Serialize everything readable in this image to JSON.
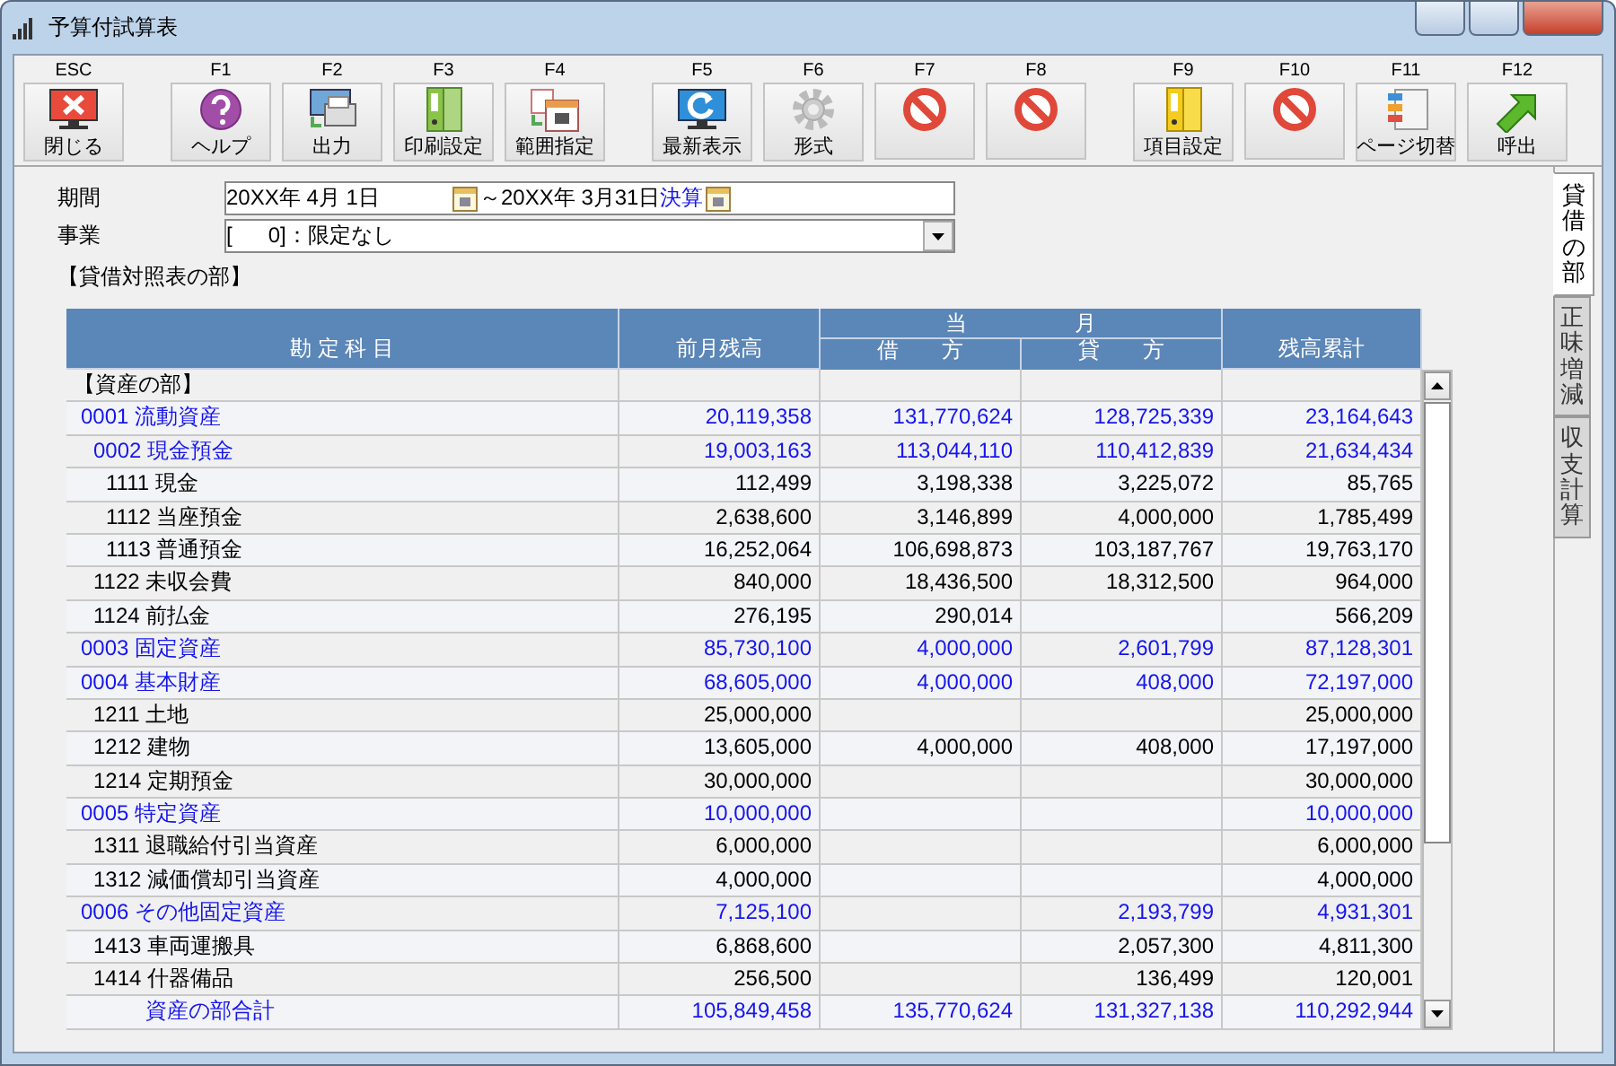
{
  "window": {
    "title": "予算付試算表"
  },
  "toolbar_groups": [
    [
      {
        "key": "ESC",
        "label": "閉じる",
        "kind": "close"
      }
    ],
    [
      {
        "key": "F1",
        "label": "ヘルプ",
        "kind": "help"
      },
      {
        "key": "F2",
        "label": "出力",
        "kind": "output"
      },
      {
        "key": "F3",
        "label": "印刷設定",
        "kind": "binder"
      },
      {
        "key": "F4",
        "label": "範囲指定",
        "kind": "calendar"
      }
    ],
    [
      {
        "key": "F5",
        "label": "最新表示",
        "kind": "refresh"
      },
      {
        "key": "F6",
        "label": "形式",
        "kind": "gear"
      },
      {
        "key": "F7",
        "kind": "blocked"
      },
      {
        "key": "F8",
        "kind": "blocked"
      }
    ],
    [
      {
        "key": "F9",
        "label": "項目設定",
        "kind": "folder"
      },
      {
        "key": "F10",
        "kind": "blocked"
      },
      {
        "key": "F11",
        "label": "ページ切替",
        "kind": "pages"
      },
      {
        "key": "F12",
        "label": "呼出",
        "kind": "arrow"
      }
    ]
  ],
  "filter": {
    "period_label": "期間",
    "period_from": "20XX年 4月 1日",
    "period_to": "～20XX年 3月31日",
    "settlement": "決算",
    "business_label": "事業",
    "business": "[      0]：限定なし"
  },
  "section_title": "【貸借対照表の部】",
  "table": {
    "columns": [
      "勘 定 科 目",
      "前月残高",
      "借　　方",
      "貸　　方",
      "残高累計"
    ],
    "column_group": "当　　　　　月",
    "rows": [
      {
        "kind": "heading",
        "name": "【資産の部】"
      },
      {
        "kind": "group",
        "name": "0001 流動資産",
        "prev": "20,119,358",
        "debit": "131,770,624",
        "credit": "128,725,339",
        "balance": "23,164,643",
        "children": [
          {
            "kind": "group",
            "name": "0002 現金預金",
            "prev": "19,003,163",
            "debit": "113,044,110",
            "credit": "110,412,839",
            "balance": "21,634,434",
            "children": [
              {
                "kind": "account",
                "name": "1111 現金",
                "prev": "112,499",
                "debit": "3,198,338",
                "credit": "3,225,072",
                "balance": "85,765"
              },
              {
                "kind": "account",
                "name": "1112 当座預金",
                "prev": "2,638,600",
                "debit": "3,146,899",
                "credit": "4,000,000",
                "balance": "1,785,499"
              },
              {
                "kind": "account",
                "name": "1113 普通預金",
                "prev": "16,252,064",
                "debit": "106,698,873",
                "credit": "103,187,767",
                "balance": "19,763,170"
              }
            ]
          },
          {
            "kind": "account",
            "name": "1122 未収会費",
            "prev": "840,000",
            "debit": "18,436,500",
            "credit": "18,312,500",
            "balance": "964,000"
          },
          {
            "kind": "account",
            "name": "1124 前払金",
            "prev": "276,195",
            "debit": "290,014",
            "balance": "566,209"
          }
        ]
      },
      {
        "kind": "group",
        "name": "0003 固定資産",
        "prev": "85,730,100",
        "debit": "4,000,000",
        "credit": "2,601,799",
        "balance": "87,128,301"
      },
      {
        "kind": "group",
        "name": "0004 基本財産",
        "prev": "68,605,000",
        "debit": "4,000,000",
        "credit": "408,000",
        "balance": "72,197,000",
        "children": [
          {
            "kind": "account",
            "name": "1211 土地",
            "prev": "25,000,000",
            "balance": "25,000,000"
          },
          {
            "kind": "account",
            "name": "1212 建物",
            "prev": "13,605,000",
            "debit": "4,000,000",
            "credit": "408,000",
            "balance": "17,197,000"
          },
          {
            "kind": "account",
            "name": "1214 定期預金",
            "prev": "30,000,000",
            "balance": "30,000,000"
          }
        ]
      },
      {
        "kind": "group",
        "name": "0005 特定資産",
        "prev": "10,000,000",
        "balance": "10,000,000",
        "children": [
          {
            "kind": "account",
            "name": "1311 退職給付引当資産",
            "prev": "6,000,000",
            "balance": "6,000,000"
          },
          {
            "kind": "account",
            "name": "1312 減価償却引当資産",
            "prev": "4,000,000",
            "balance": "4,000,000"
          }
        ]
      },
      {
        "kind": "group",
        "name": "0006 その他固定資産",
        "prev": "7,125,100",
        "credit": "2,193,799",
        "balance": "4,931,301",
        "children": [
          {
            "kind": "account",
            "name": "1413 車両運搬具",
            "prev": "6,868,600",
            "credit": "2,057,300",
            "balance": "4,811,300"
          },
          {
            "kind": "account",
            "name": "1414 什器備品",
            "prev": "256,500",
            "credit": "136,499",
            "balance": "120,001"
          }
        ]
      },
      {
        "kind": "total",
        "name": "資産の部合計",
        "prev": "105,849,458",
        "debit": "135,770,624",
        "credit": "131,327,138",
        "balance": "110,292,944"
      }
    ]
  },
  "side_tabs": [
    {
      "label": "貸借の部",
      "selected": true
    },
    {
      "label": "正味増減",
      "selected": false
    },
    {
      "label": "収支計算",
      "selected": false
    }
  ]
}
